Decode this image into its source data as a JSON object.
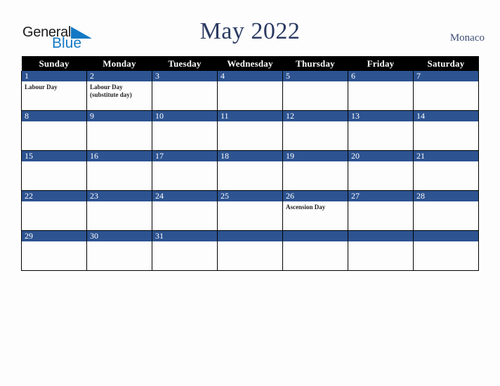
{
  "brand": {
    "word_one": "General",
    "word_two": "Blue",
    "triangle_icon": "blue-triangle-icon",
    "dark_color": "#1b1b1b",
    "blue_color": "#1479c4"
  },
  "header": {
    "title": "May 2022",
    "location": "Monaco",
    "title_color": "#2b3a61",
    "location_color": "#3c4d73"
  },
  "theme": {
    "date_bar_color": "#2d5391",
    "header_row_color": "#000000",
    "cell_background": "#fdfdfd",
    "page_background": "#fdfdfd",
    "grid_line_color": "#000000"
  },
  "calendar": {
    "weekday_headers": [
      "Sunday",
      "Monday",
      "Tuesday",
      "Wednesday",
      "Thursday",
      "Friday",
      "Saturday"
    ],
    "weeks": [
      [
        {
          "date": "1",
          "events": [
            "Labour Day"
          ]
        },
        {
          "date": "2",
          "events": [
            "Labour Day",
            "(substitute day)"
          ]
        },
        {
          "date": "3",
          "events": []
        },
        {
          "date": "4",
          "events": []
        },
        {
          "date": "5",
          "events": []
        },
        {
          "date": "6",
          "events": []
        },
        {
          "date": "7",
          "events": []
        }
      ],
      [
        {
          "date": "8",
          "events": []
        },
        {
          "date": "9",
          "events": []
        },
        {
          "date": "10",
          "events": []
        },
        {
          "date": "11",
          "events": []
        },
        {
          "date": "12",
          "events": []
        },
        {
          "date": "13",
          "events": []
        },
        {
          "date": "14",
          "events": []
        }
      ],
      [
        {
          "date": "15",
          "events": []
        },
        {
          "date": "16",
          "events": []
        },
        {
          "date": "17",
          "events": []
        },
        {
          "date": "18",
          "events": []
        },
        {
          "date": "19",
          "events": []
        },
        {
          "date": "20",
          "events": []
        },
        {
          "date": "21",
          "events": []
        }
      ],
      [
        {
          "date": "22",
          "events": []
        },
        {
          "date": "23",
          "events": []
        },
        {
          "date": "24",
          "events": []
        },
        {
          "date": "25",
          "events": []
        },
        {
          "date": "26",
          "events": [
            "Ascension Day"
          ]
        },
        {
          "date": "27",
          "events": []
        },
        {
          "date": "28",
          "events": []
        }
      ],
      [
        {
          "date": "29",
          "events": []
        },
        {
          "date": "30",
          "events": []
        },
        {
          "date": "31",
          "events": []
        },
        {
          "date": "",
          "events": []
        },
        {
          "date": "",
          "events": []
        },
        {
          "date": "",
          "events": []
        },
        {
          "date": "",
          "events": []
        }
      ]
    ]
  }
}
